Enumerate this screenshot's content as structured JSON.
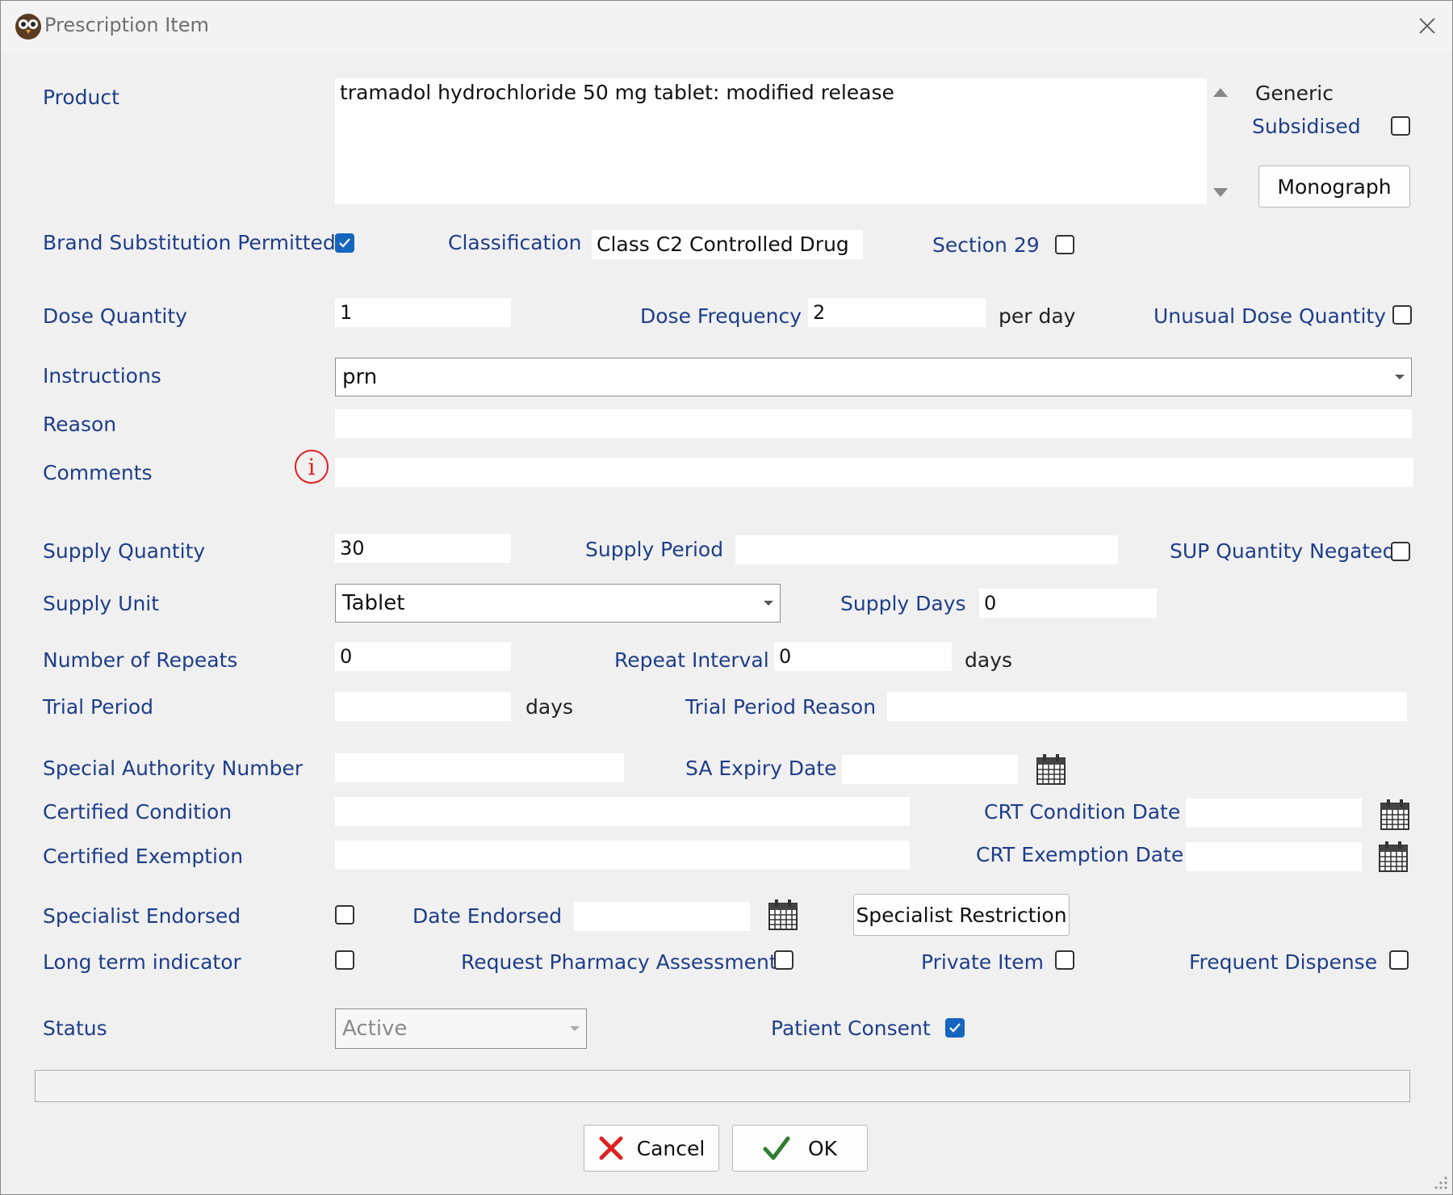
{
  "window": {
    "title": "Prescription Item"
  },
  "product": {
    "label": "Product",
    "value": "tramadol hydrochloride 50 mg tablet: modified release",
    "generic_label": "Generic",
    "subsidised_label": "Subsidised",
    "subsidised_checked": false,
    "monograph_button": "Monograph"
  },
  "brand_substitution": {
    "label": "Brand Substitution Permitted",
    "checked": true
  },
  "classification": {
    "label": "Classification",
    "value": "Class C2 Controlled Drug"
  },
  "section29": {
    "label": "Section 29",
    "checked": false
  },
  "dose": {
    "quantity_label": "Dose Quantity",
    "quantity_value": "1",
    "frequency_label": "Dose Frequency",
    "frequency_value": "2",
    "per_day": "per day",
    "unusual_label": "Unusual Dose Quantity",
    "unusual_checked": false
  },
  "instructions": {
    "label": "Instructions",
    "value": "prn"
  },
  "reason": {
    "label": "Reason",
    "value": ""
  },
  "comments": {
    "label": "Comments",
    "value": "",
    "info_glyph": "i"
  },
  "supply": {
    "quantity_label": "Supply Quantity",
    "quantity_value": "30",
    "period_label": "Supply Period",
    "period_value": "",
    "sup_negated_label": "SUP Quantity Negated",
    "sup_negated_checked": false,
    "unit_label": "Supply Unit",
    "unit_value": "Tablet",
    "days_label": "Supply Days",
    "days_value": "0"
  },
  "repeats": {
    "label": "Number of Repeats",
    "value": "0",
    "interval_label": "Repeat Interval",
    "interval_value": "0",
    "days_unit": "days"
  },
  "trial": {
    "label": "Trial Period",
    "value": "",
    "days_unit": "days",
    "reason_label": "Trial Period Reason",
    "reason_value": ""
  },
  "special_authority": {
    "label": "Special Authority Number",
    "value": "",
    "expiry_label": "SA Expiry Date",
    "expiry_value": ""
  },
  "certified_condition": {
    "label": "Certified Condition",
    "value": "",
    "date_label": "CRT Condition Date",
    "date_value": ""
  },
  "certified_exemption": {
    "label": "Certified Exemption",
    "value": "",
    "date_label": "CRT Exemption Date",
    "date_value": ""
  },
  "specialist": {
    "label": "Specialist Endorsed",
    "checked": false,
    "date_label": "Date Endorsed",
    "date_value": "",
    "restriction_button": "Specialist Restriction"
  },
  "flags": {
    "long_term_label": "Long term indicator",
    "long_term_checked": false,
    "pharmacy_assessment_label": "Request Pharmacy Assessment",
    "pharmacy_assessment_checked": false,
    "private_item_label": "Private Item",
    "private_item_checked": false,
    "frequent_dispense_label": "Frequent Dispense",
    "frequent_dispense_checked": false
  },
  "status": {
    "label": "Status",
    "value": "Active",
    "consent_label": "Patient Consent",
    "consent_checked": true
  },
  "buttons": {
    "cancel": "Cancel",
    "ok": "OK"
  },
  "colors": {
    "label_blue": "#1e3e8a",
    "checkbox_blue": "#1565c0",
    "cancel_red": "#e02020",
    "ok_green": "#2e7d32",
    "info_red": "#e02020"
  },
  "icons": {
    "app": "owl-icon",
    "close": "close-icon",
    "calendar": "calendar-icon",
    "cancel": "red-x-icon",
    "ok": "green-check-icon",
    "info": "info-circle-icon"
  }
}
